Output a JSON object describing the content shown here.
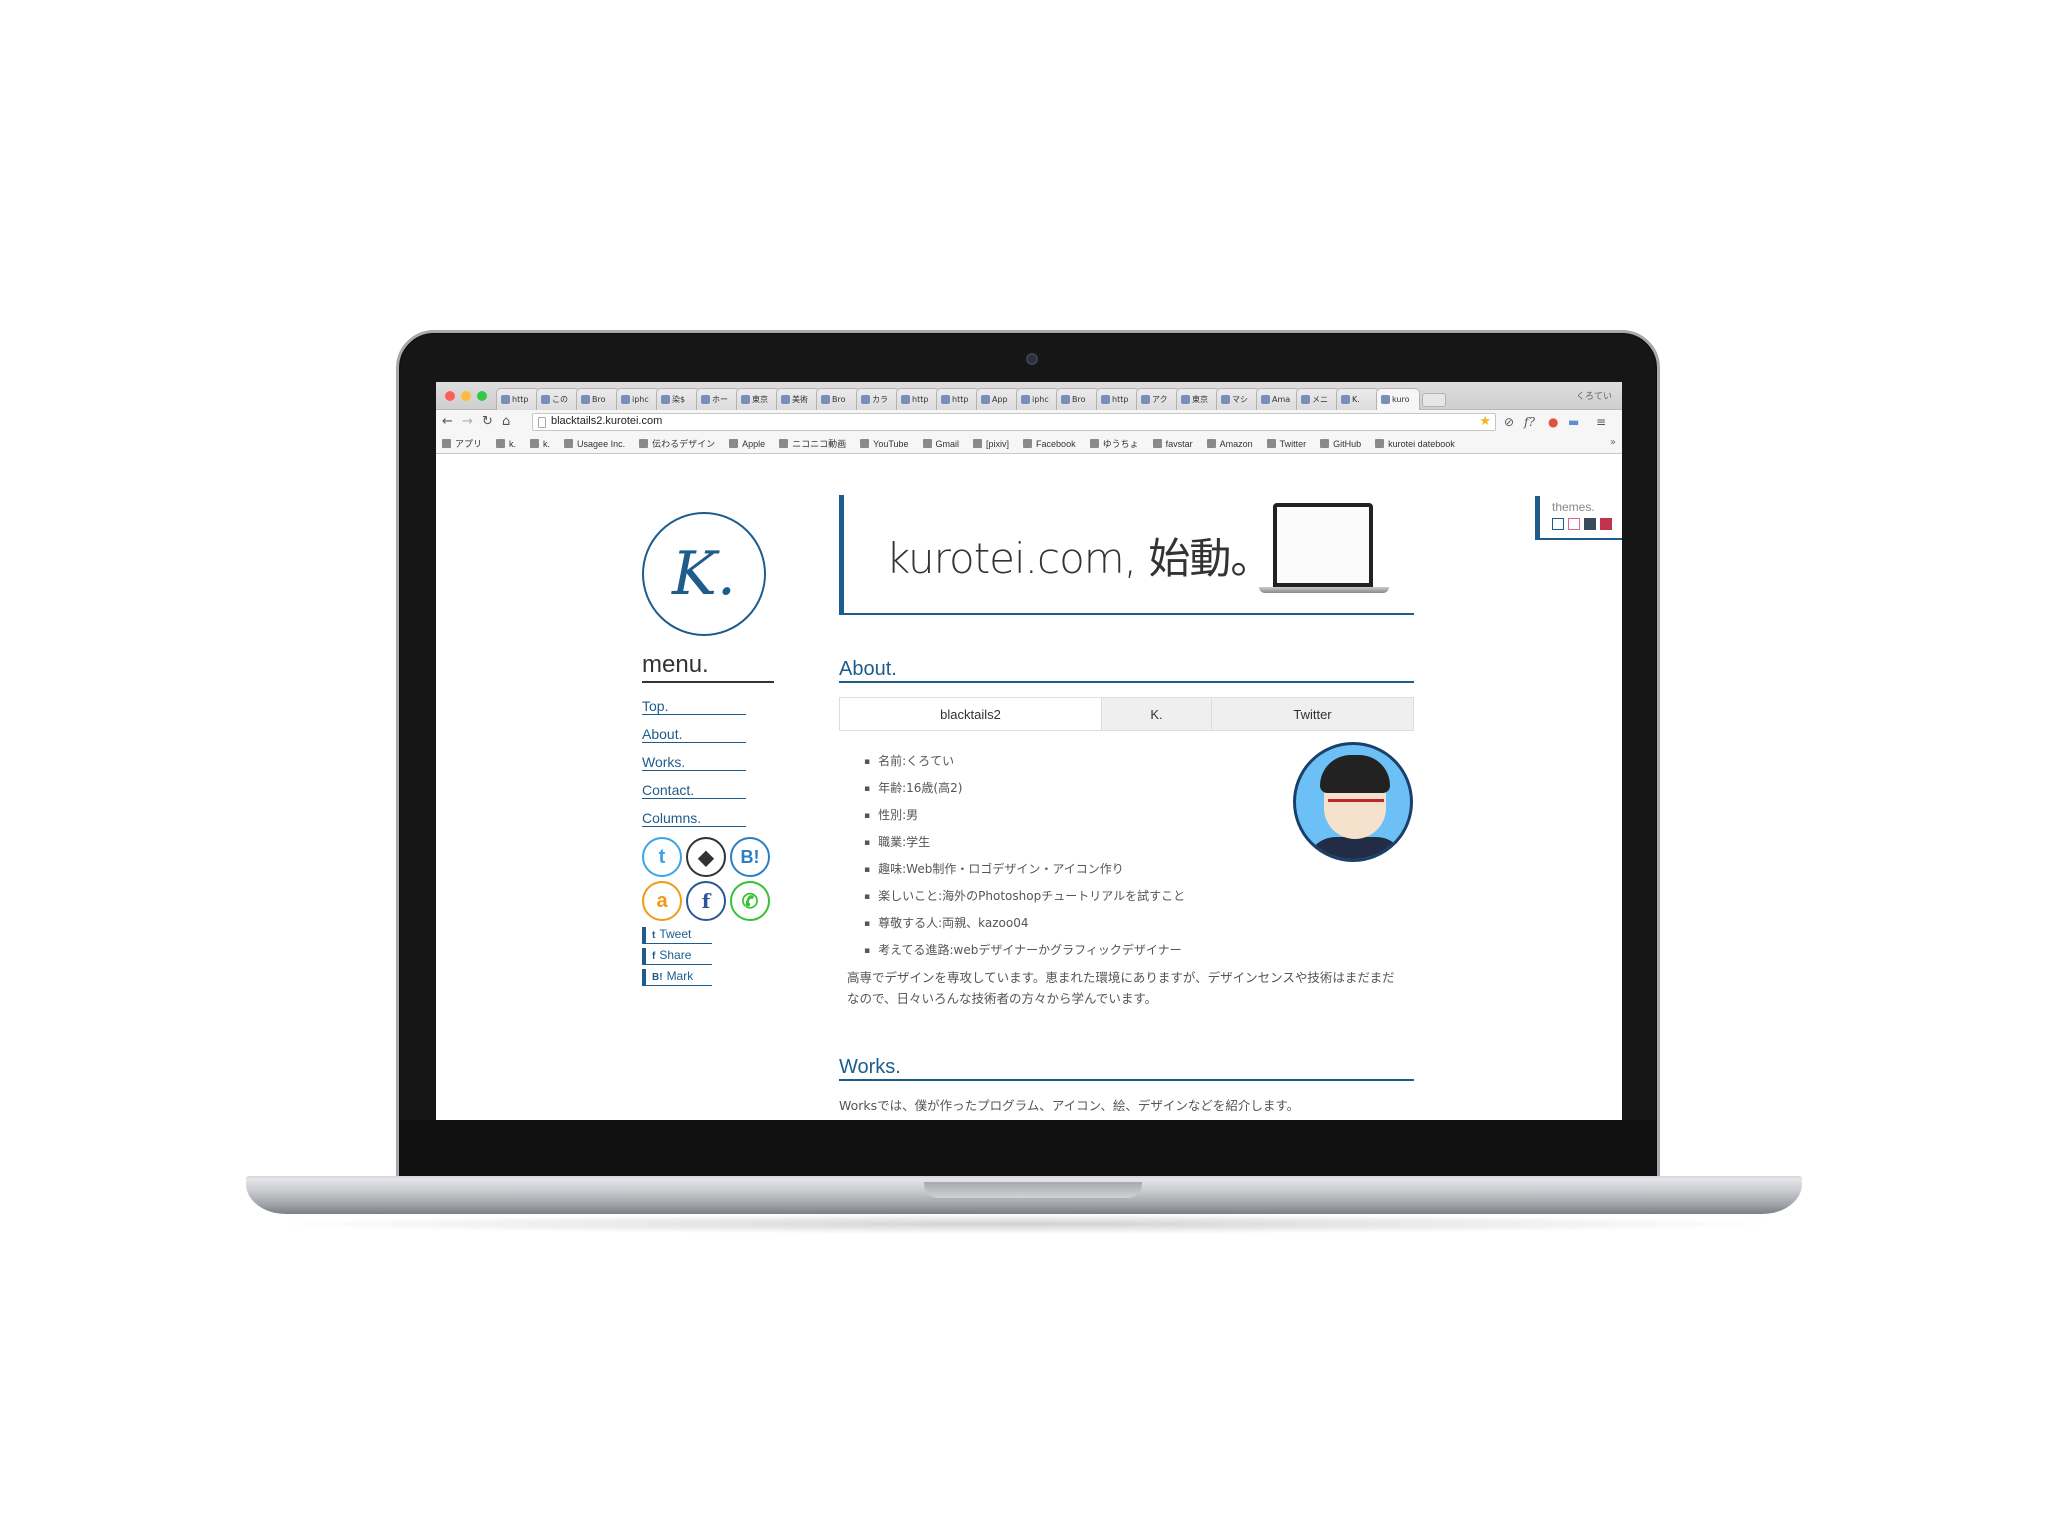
{
  "browser": {
    "tabs": [
      "http",
      "この",
      "Bro",
      "iphc",
      "染$",
      "ホー",
      "東京",
      "美術",
      "Bro",
      "カラ",
      "http",
      "http",
      "App",
      "iphc",
      "Bro",
      "http",
      "アク",
      "東京",
      "マシ",
      "Ama",
      "メニ",
      "K.",
      "kuro"
    ],
    "profile": "くろてい",
    "url": "blacktails2.kurotei.com",
    "bookmarks": [
      "アプリ",
      "k.",
      "k.",
      "Usagee Inc.",
      "伝わるデザイン",
      "Apple",
      "ニコニコ動画",
      "YouTube",
      "Gmail",
      "[pixiv]",
      "Facebook",
      "ゆうちょ",
      "favstar",
      "Amazon",
      "Twitter",
      "GitHub",
      "kurotei datebook"
    ],
    "bookmarks_more": "»"
  },
  "site": {
    "logo": "K.",
    "menu_title": "menu.",
    "menu": [
      "Top.",
      "About.",
      "Works.",
      "Contact.",
      "Columns."
    ],
    "social_icons": [
      "twitter-icon",
      "github-icon",
      "hatena-bookmark-icon",
      "amazon-icon",
      "facebook-icon",
      "line-icon"
    ],
    "social_glyphs": [
      "t",
      "◆",
      "B!",
      "a",
      "f",
      "✆"
    ],
    "share": [
      {
        "icon": "t",
        "label": "Tweet"
      },
      {
        "icon": "f",
        "label": "Share"
      },
      {
        "icon": "B!",
        "label": "Mark"
      }
    ],
    "headline": "kurotei.com, 始動。",
    "about_title": "About.",
    "about_tabs": [
      "blacktails2",
      "K.",
      "Twitter"
    ],
    "profile": [
      "名前:くろてい",
      "年齢:16歳(高2)",
      "性別:男",
      "職業:学生",
      "趣味:Web制作・ロゴデザイン・アイコン作り",
      "楽しいこと:海外のPhotoshopチュートリアルを試すこと",
      "尊敬する人:両親、kazoo04",
      "考えてる進路:webデザイナーかグラフィックデザイナー"
    ],
    "bio": "高専でデザインを専攻しています。恵まれた環境にありますが、デザインセンスや技術はまだまだなので、日々いろんな技術者の方々から学んでいます。",
    "works_title": "Works.",
    "works_text": "Worksでは、僕が作ったプログラム、アイコン、絵、デザインなどを紹介します。",
    "themes_label": "themes.",
    "theme_colors": [
      "#ffffff",
      "#ffffff",
      "#3a4a5c",
      "#c2334d"
    ],
    "theme_borders": [
      "#1e5c8c",
      "#e0668a",
      "#3a4a5c",
      "#c2334d"
    ],
    "accent_color": "#1e5c8c"
  }
}
